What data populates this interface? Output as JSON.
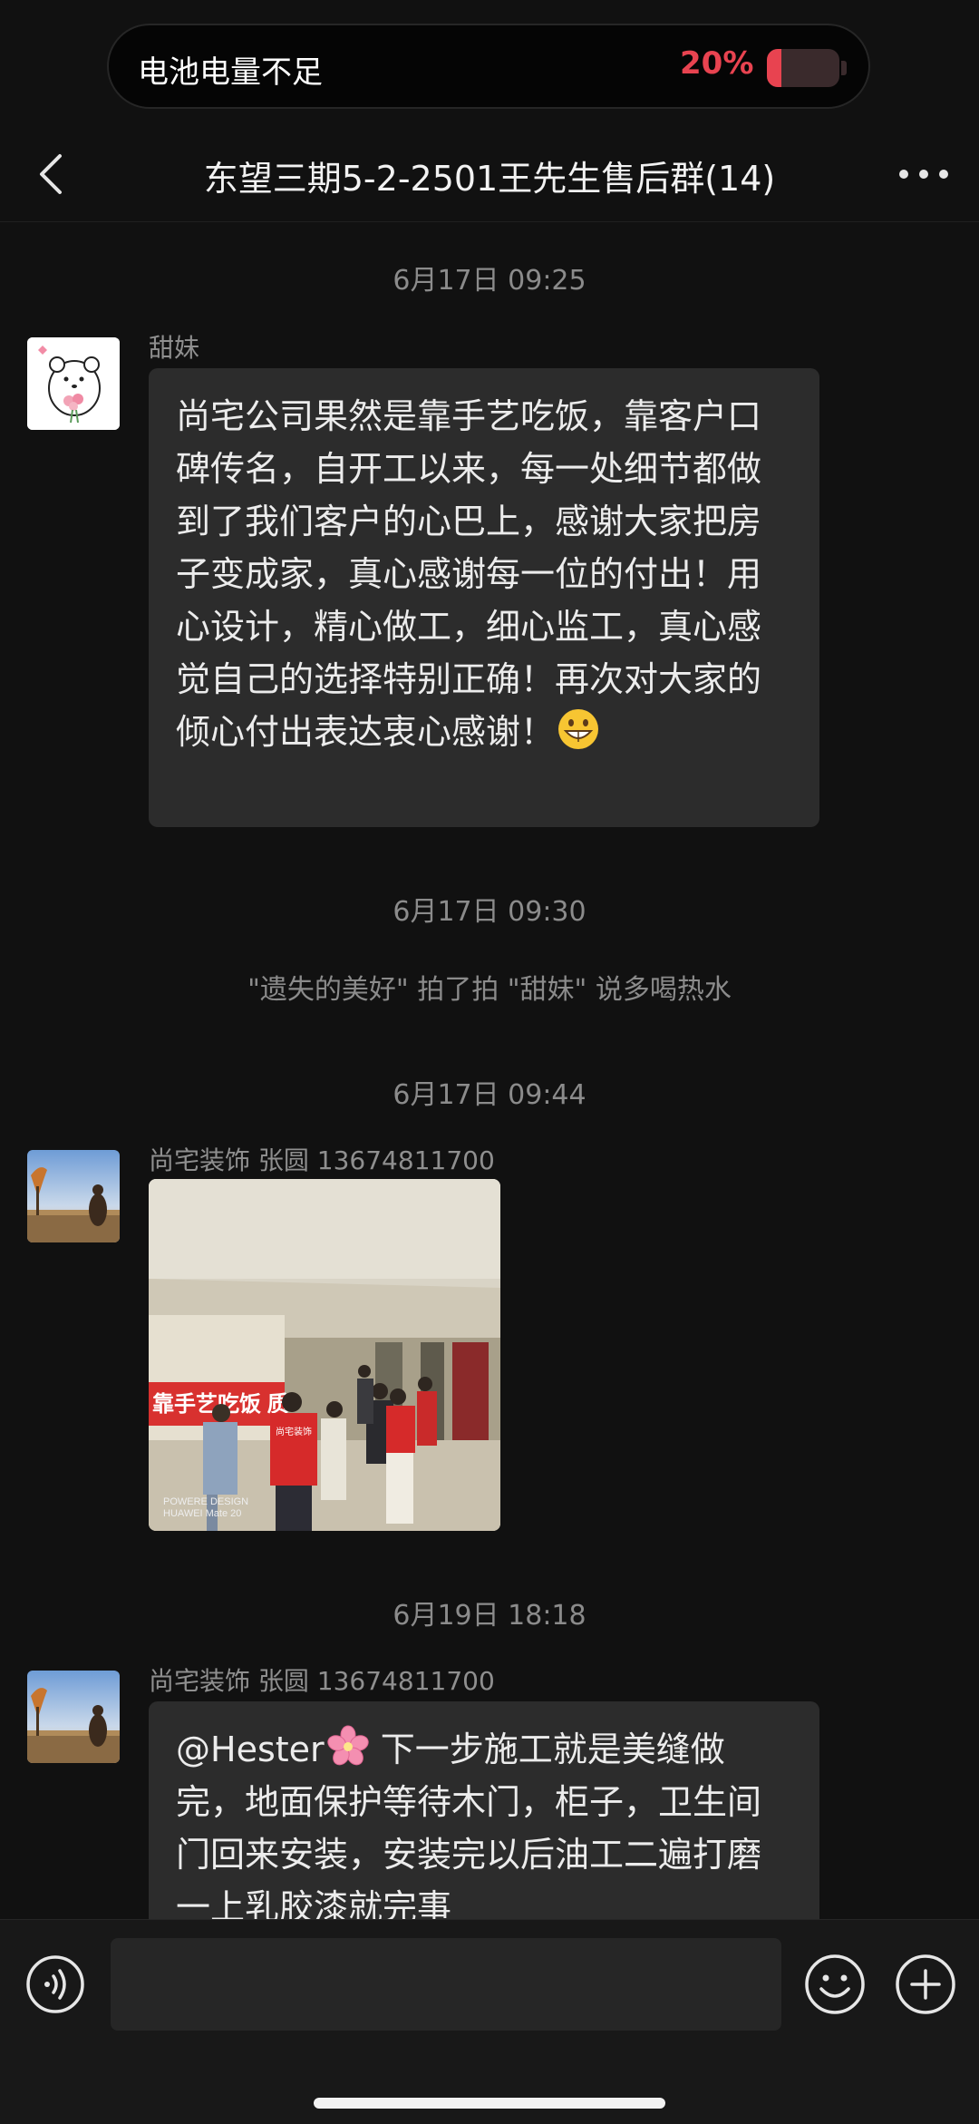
{
  "toast": {
    "text": "电池电量不足",
    "percent": "20%",
    "level": 0.2
  },
  "header": {
    "title": "东望三期5-2-2501王先生售后群(14)"
  },
  "messages": {
    "t1": "6月17日 09:25",
    "m1": {
      "sender": "甜妹",
      "text": "尚宅公司果然是靠手艺吃饭，靠客户口碑传名，自开工以来，每一处细节都做到了我们客户的心巴上，感谢大家把房子变成家，真心感谢每一位的付出！用心设计，精心做工，细心监工，真心感觉自己的选择特别正确！再次对大家的倾心付出表达衷心感谢！",
      "emoji": "grinning-face"
    },
    "t2": "6月17日 09:30",
    "system": "\"遗失的美好\" 拍了拍 \"甜妹\" 说多喝热水",
    "t3": "6月17日 09:44",
    "m2": {
      "sender": "尚宅装饰 张圆 13674811700",
      "banner_text": "靠手艺吃饭 质",
      "vest_text": "尚宅装饰",
      "watermark": "POWERE DESIGN\nHUAWEI Mate 20"
    },
    "t4": "6月19日 18:18",
    "m3": {
      "sender": "尚宅装饰 张圆 13674811700",
      "text_a": "@Hester",
      "text_b": " 下一步施工就是美缝做完，地面保护等待木门，柜子，卫生间门回来安装，安装完以后油工二遍打磨一上乳胶漆就完事"
    }
  },
  "icons": {
    "back": "chevron-left-icon",
    "more": "more-dots-icon",
    "voice": "voice-icon",
    "emoji": "emoji-icon",
    "plus": "plus-icon"
  },
  "colors": {
    "accent_red": "#e84350",
    "bubble": "#2c2c2c",
    "background": "#111111"
  }
}
